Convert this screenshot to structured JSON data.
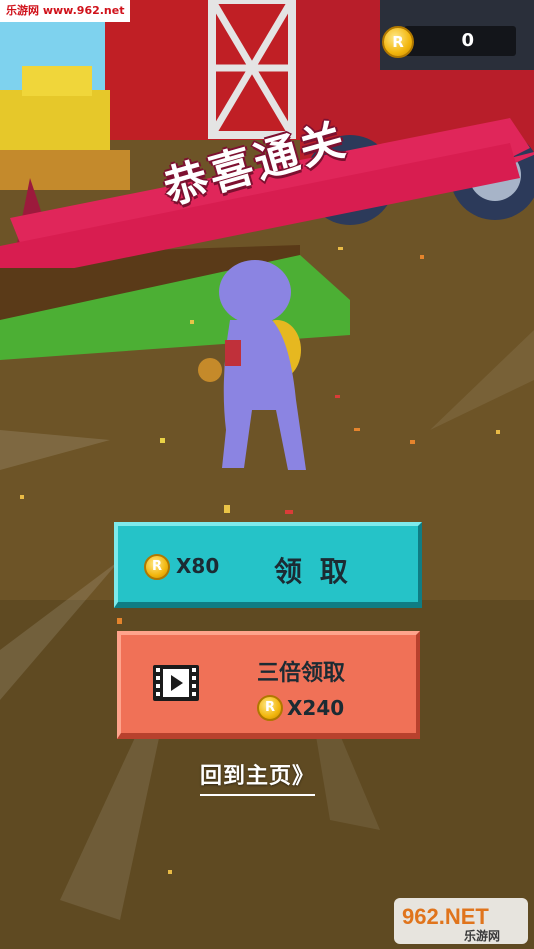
{
  "watermark": {
    "top_left": "乐游网 www.962.net",
    "bottom_right_logo": "962.NET",
    "bottom_right_sub": "乐游网"
  },
  "hud": {
    "coin_symbol": "R",
    "coin_count": "0",
    "coin_icon": "coin-icon"
  },
  "banner": {
    "title": "恭喜通关",
    "color": "#e0265a"
  },
  "reward": {
    "claim": {
      "coin_symbol": "R",
      "amount": "X80",
      "label": "领 取",
      "color": "#25c3c8"
    },
    "triple": {
      "icon": "video-icon",
      "label": "三倍领取",
      "coin_symbol": "R",
      "amount": "X240",
      "color": "#f07157"
    }
  },
  "back_home": "回到主页》"
}
